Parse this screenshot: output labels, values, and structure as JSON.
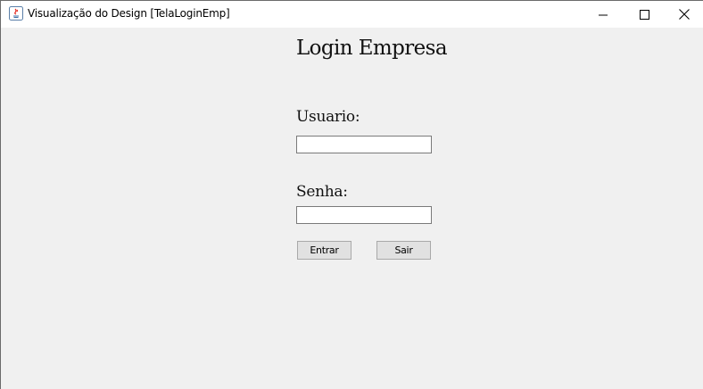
{
  "window": {
    "title": "Visualização do Design [TelaLoginEmp]",
    "app_icon": "java-icon",
    "controls": {
      "minimize": "minimize-icon",
      "maximize": "maximize-icon",
      "close": "close-icon"
    }
  },
  "form": {
    "heading": "Login Empresa",
    "user_label": "Usuario:",
    "user_value": "",
    "password_label": "Senha:",
    "password_value": "",
    "enter_label": "Entrar",
    "exit_label": "Sair"
  },
  "colors": {
    "background": "#f0f0f0",
    "titlebar": "#ffffff",
    "button": "#e1e1e1"
  }
}
